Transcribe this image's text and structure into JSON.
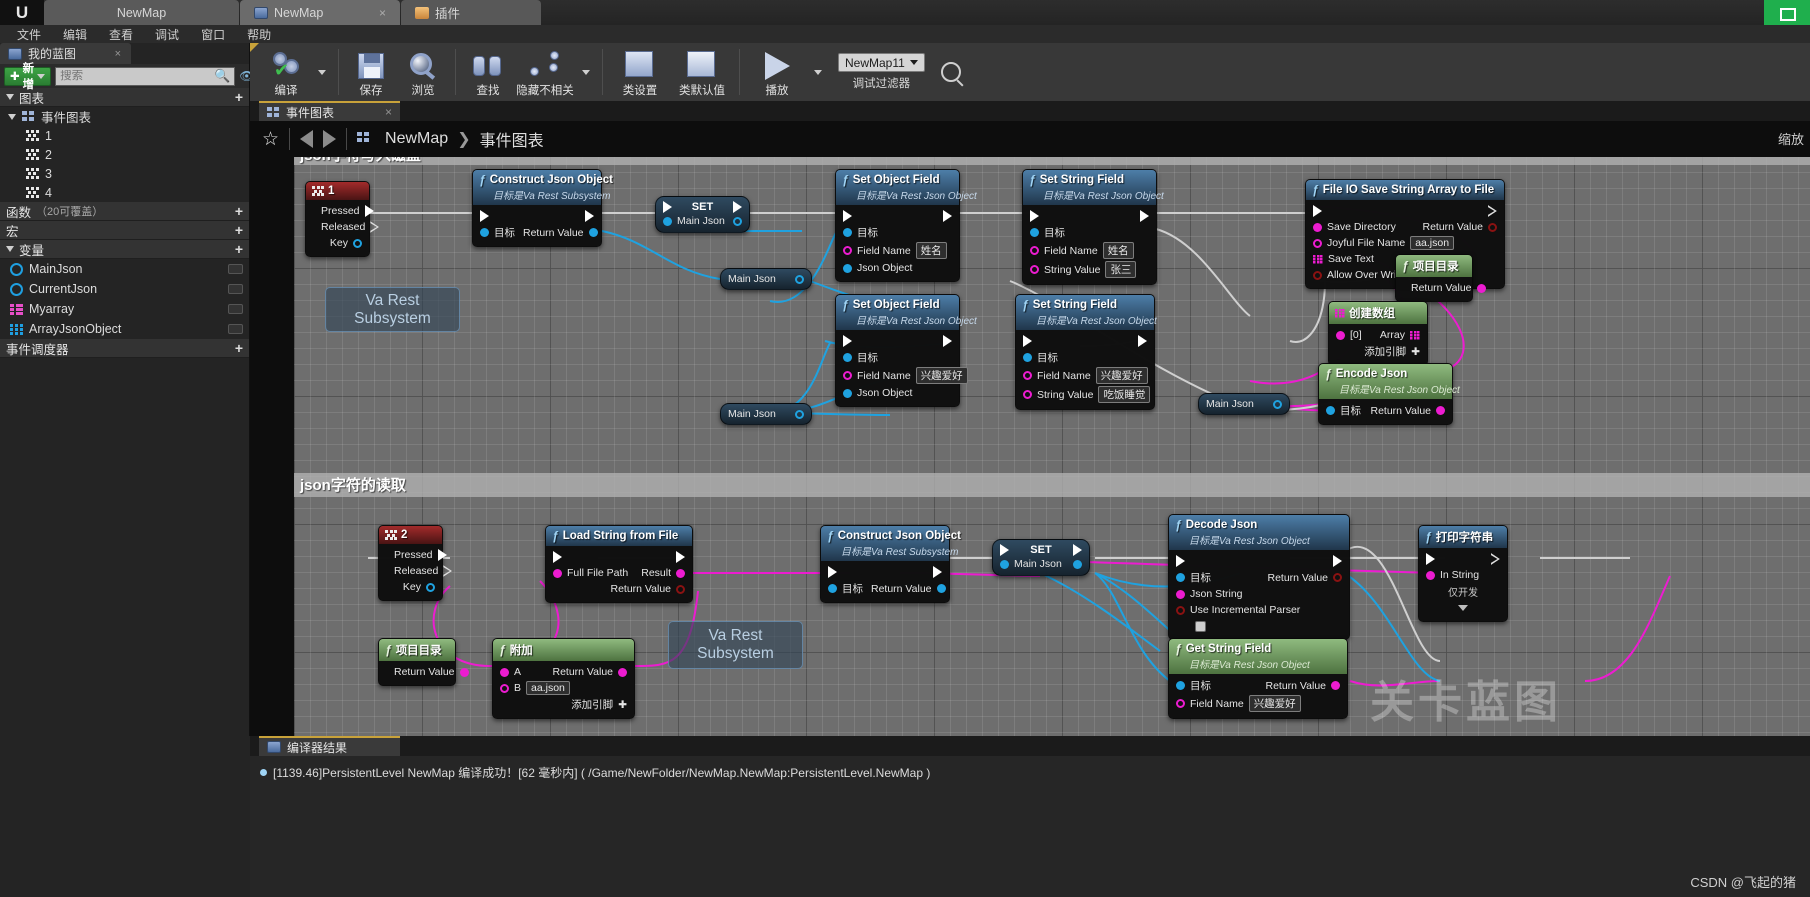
{
  "window": {
    "app_tab": "NewMap",
    "doc_tab": "NewMap",
    "plugin_tab": "插件",
    "close_glyph": "×",
    "logo_glyph": "U"
  },
  "menu": {
    "items": [
      "文件",
      "编辑",
      "查看",
      "调试",
      "窗口",
      "帮助"
    ]
  },
  "left_panel": {
    "tab_label": "我的蓝图",
    "add_label": "新增",
    "search_placeholder": "搜索",
    "sections": {
      "graphs": "图表",
      "event_graph": "事件图表",
      "functions": "函数",
      "functions_note": "（20可覆盖）",
      "macros": "宏",
      "variables": "变量",
      "event_dispatchers": "事件调度器"
    },
    "graph_items": [
      "1",
      "2",
      "3",
      "4"
    ],
    "variables": [
      {
        "name": "MainJson",
        "kind": "object"
      },
      {
        "name": "CurrentJson",
        "kind": "object"
      },
      {
        "name": "Myarray",
        "kind": "array-pink"
      },
      {
        "name": "ArrayJsonObject",
        "kind": "array-blue"
      }
    ]
  },
  "toolbar": {
    "compile": "编译",
    "save": "保存",
    "browse": "浏览",
    "find": "查找",
    "hide_unrelated": "隐藏不相关",
    "class_settings": "类设置",
    "class_defaults": "类默认值",
    "play": "播放",
    "debug_filter_value": "NewMap11",
    "debug_filter_label": "调试过滤器"
  },
  "graph_tab": {
    "label": "事件图表",
    "close_glyph": "×"
  },
  "breadcrumb": {
    "star_glyph": "☆",
    "root": "NewMap",
    "separator": "❯",
    "leaf": "事件图表",
    "zoom_label": "缩放"
  },
  "comments": [
    {
      "title": "json字符写入磁盘"
    },
    {
      "title": "json字符的读取"
    }
  ],
  "watermark": "关卡蓝图",
  "subsystem_boxes": [
    {
      "line1": "Va Rest",
      "line2": "Subsystem"
    },
    {
      "line1": "Va Rest",
      "line2": "Subsystem"
    }
  ],
  "nodes": [
    {
      "id": "key1",
      "title": "1",
      "pins": [
        {
          "label": "Pressed",
          "type": "exec-out"
        },
        {
          "label": "Released",
          "type": "exec-out-hollow"
        },
        {
          "label": "Key",
          "type": "key-out"
        }
      ]
    },
    {
      "id": "construct_json_1",
      "title": "Construct Json Object",
      "subtitle": "目标是Va Rest Subsystem",
      "pin_target": "目标",
      "pin_return": "Return Value"
    },
    {
      "id": "set_1",
      "title": "SET",
      "pin_var": "Main Json"
    },
    {
      "id": "set_object_field_1",
      "title": "Set Object Field",
      "subtitle": "目标是Va Rest Json Object",
      "pin_target": "目标",
      "pin_field_name": "Field Name",
      "field_name_value": "姓名",
      "pin_json_object": "Json Object"
    },
    {
      "id": "set_string_field_1",
      "title": "Set String Field",
      "subtitle": "目标是Va Rest Json Object",
      "pin_target": "目标",
      "pin_field_name": "Field Name",
      "field_name_value": "姓名",
      "pin_string_value": "String Value",
      "string_value": "张三"
    },
    {
      "id": "set_object_field_2",
      "title": "Set Object Field",
      "subtitle": "目标是Va Rest Json Object",
      "pin_target": "目标",
      "pin_field_name": "Field Name",
      "field_name_value": "兴趣爱好",
      "pin_json_object": "Json Object"
    },
    {
      "id": "set_string_field_2",
      "title": "Set String Field",
      "subtitle": "目标是Va Rest Json Object",
      "pin_target": "目标",
      "pin_field_name": "Field Name",
      "field_name_value": "兴趣爱好",
      "pin_string_value": "String Value",
      "string_value": "吃饭睡觉"
    },
    {
      "id": "file_io_save",
      "title": "File IO  Save String Array to File",
      "pin_save_directory": "Save Directory",
      "pin_joyful_file_name": "Joyful File Name",
      "joyful_file_name_value": "aa.json",
      "pin_save_text": "Save Text",
      "pin_allow_over_writing": "Allow Over Writing",
      "pin_return": "Return Value"
    },
    {
      "id": "project_dir_1",
      "title": "项目目录",
      "pin_return": "Return Value"
    },
    {
      "id": "make_array",
      "title": "创建数组",
      "pin_index0": "[0]",
      "pin_array": "Array",
      "add_pin": "添加引脚"
    },
    {
      "id": "encode_json",
      "title": "Encode Json",
      "subtitle": "目标是Va Rest Json Object",
      "pin_target": "目标",
      "pin_return": "Return Value"
    },
    {
      "id": "mainjson_get_1",
      "title": "Main Json"
    },
    {
      "id": "mainjson_get_2",
      "title": "Main Json"
    },
    {
      "id": "mainjson_get_3",
      "title": "Main Json"
    },
    {
      "id": "key2",
      "title": "2",
      "pins": [
        {
          "label": "Pressed",
          "type": "exec-out"
        },
        {
          "label": "Released",
          "type": "exec-out-hollow"
        },
        {
          "label": "Key",
          "type": "key-out"
        }
      ]
    },
    {
      "id": "load_string_from_file",
      "title": "Load String from File",
      "pin_full_file_path": "Full File Path",
      "pin_result": "Result",
      "pin_return": "Return Value"
    },
    {
      "id": "construct_json_2",
      "title": "Construct Json Object",
      "subtitle": "目标是Va Rest Subsystem",
      "pin_target": "目标",
      "pin_return": "Return Value"
    },
    {
      "id": "set_2",
      "title": "SET",
      "pin_var": "Main Json"
    },
    {
      "id": "decode_json",
      "title": "Decode Json",
      "subtitle": "目标是Va Rest Json Object",
      "pin_target": "目标",
      "pin_json_string": "Json String",
      "pin_use_incremental_parser": "Use Incremental Parser",
      "pin_return": "Return Value"
    },
    {
      "id": "get_string_field",
      "title": "Get String Field",
      "subtitle": "目标是Va Rest Json Object",
      "pin_target": "目标",
      "pin_field_name": "Field Name",
      "field_name_value": "兴趣爱好",
      "pin_return": "Return Value"
    },
    {
      "id": "print_string",
      "title": "打印字符串",
      "pin_in_string": "In String",
      "dev_only": "仅开发"
    },
    {
      "id": "project_dir_2",
      "title": "项目目录",
      "pin_return": "Return Value"
    },
    {
      "id": "append",
      "title": "附加",
      "pin_a": "A",
      "pin_b": "B",
      "b_value": "aa.json",
      "pin_return": "Return Value",
      "add_pin": "添加引脚"
    }
  ],
  "results": {
    "tab_label": "编译器结果",
    "log": "[1139.46]PersistentLevel NewMap 编译成功！[62 毫秒内] ( /Game/NewFolder/NewMap.NewMap:PersistentLevel.NewMap )"
  },
  "footer": {
    "csdn": "CSDN @飞起的猪"
  }
}
